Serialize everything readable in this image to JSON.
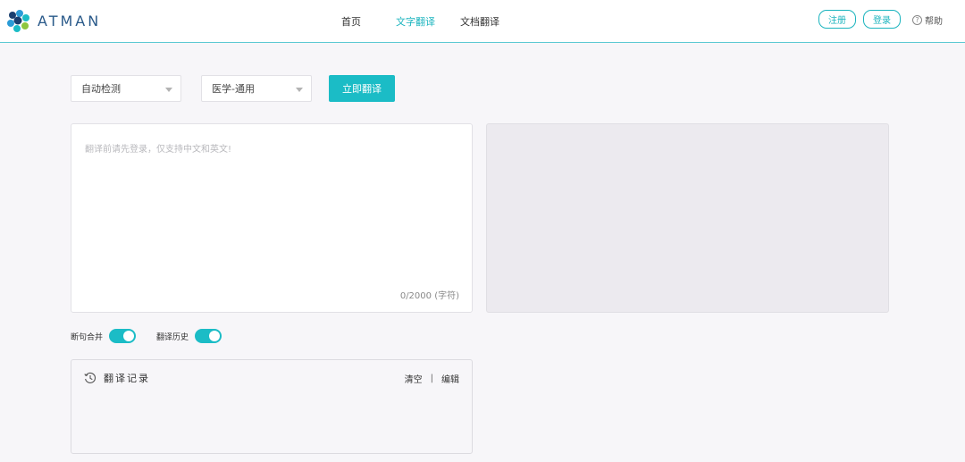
{
  "brand": {
    "logo_text": "ATMAN"
  },
  "nav": {
    "items": [
      {
        "label": "首页",
        "active": false
      },
      {
        "label": "文字翻译",
        "active": true
      },
      {
        "label": "文档翻译",
        "active": false
      }
    ]
  },
  "auth": {
    "register": "注册",
    "login": "登录",
    "help": "帮助",
    "help_icon": "question-circle-icon"
  },
  "controls": {
    "source_lang": "自动检测",
    "domain": "医学-通用",
    "translate_button": "立即翻译"
  },
  "source": {
    "placeholder": "翻译前请先登录，仅支持中文和英文!",
    "value": "",
    "char_count": "0/2000 (字符)"
  },
  "toggles": {
    "sentence_merge": {
      "label": "断句合并",
      "on": true
    },
    "history": {
      "label": "翻译历史",
      "on": true
    }
  },
  "history": {
    "title": "翻译记录",
    "icon": "history-clock-icon",
    "clear": "清空",
    "separator": "|",
    "edit": "编辑"
  },
  "colors": {
    "accent": "#1bbcc6",
    "background": "#f7f6f9",
    "target_panel": "#eceaef"
  }
}
